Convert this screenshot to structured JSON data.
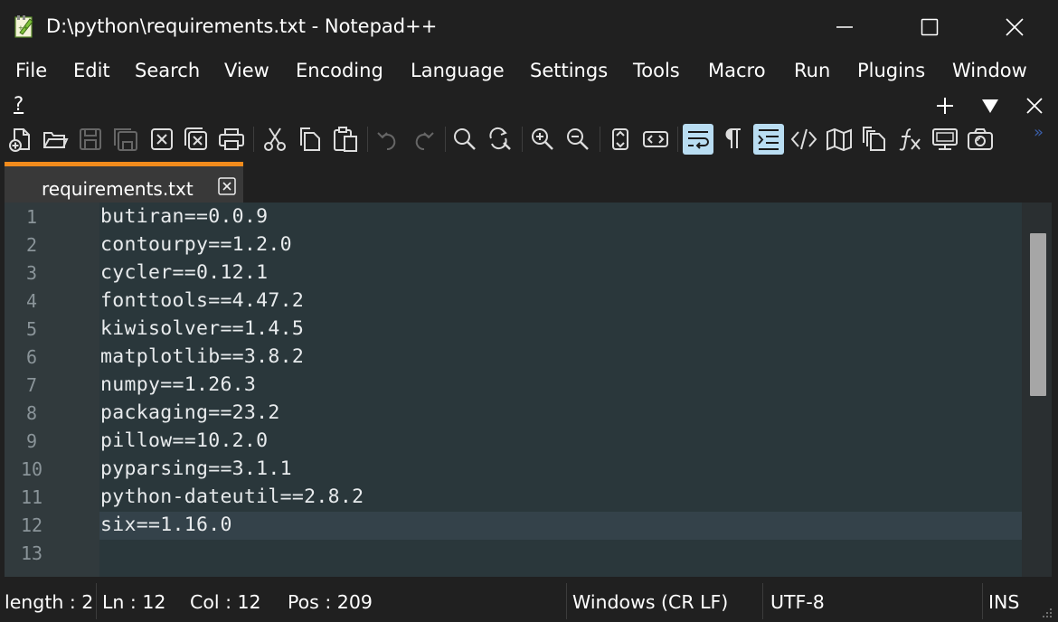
{
  "window": {
    "title": "D:\\python\\requirements.txt - Notepad++"
  },
  "menu": {
    "items": [
      "File",
      "Edit",
      "Search",
      "View",
      "Encoding",
      "Language",
      "Settings",
      "Tools",
      "Macro",
      "Run",
      "Plugins",
      "Window"
    ],
    "help": "?"
  },
  "toolbar": {
    "icons": [
      "new-file-icon",
      "open-file-icon",
      "save-icon",
      "save-all-icon",
      "close-icon",
      "close-all-icon",
      "print-icon",
      "cut-icon",
      "copy-icon",
      "paste-icon",
      "undo-icon",
      "redo-icon",
      "find-icon",
      "replace-icon",
      "zoom-in-icon",
      "zoom-out-icon",
      "sync-vertical-icon",
      "sync-horizontal-icon",
      "word-wrap-icon",
      "show-all-chars-icon",
      "indent-guide-icon",
      "udl-icon",
      "document-map-icon",
      "document-list-icon",
      "function-list-icon",
      "folder-workspace-icon",
      "monitoring-icon"
    ],
    "active": [
      "word-wrap-icon",
      "indent-guide-icon"
    ],
    "overflow": "»"
  },
  "tab": {
    "label": "requirements.txt"
  },
  "editor": {
    "lines": [
      {
        "n": "1",
        "text": "butiran==0.0.9"
      },
      {
        "n": "2",
        "text": "contourpy==1.2.0"
      },
      {
        "n": "3",
        "text": "cycler==0.12.1"
      },
      {
        "n": "4",
        "text": "fonttools==4.47.2"
      },
      {
        "n": "5",
        "text": "kiwisolver==1.4.5"
      },
      {
        "n": "6",
        "text": "matplotlib==3.8.2"
      },
      {
        "n": "7",
        "text": "numpy==1.26.3"
      },
      {
        "n": "8",
        "text": "packaging==23.2"
      },
      {
        "n": "9",
        "text": "pillow==10.2.0"
      },
      {
        "n": "10",
        "text": "pyparsing==3.1.1"
      },
      {
        "n": "11",
        "text": "python-dateutil==2.8.2"
      },
      {
        "n": "12",
        "text": "six==1.16.0"
      },
      {
        "n": "13",
        "text": ""
      }
    ],
    "current_line": 12
  },
  "status": {
    "length": "length : 2",
    "ln": "Ln : 12",
    "col": "Col : 12",
    "pos": "Pos : 209",
    "eol": "Windows (CR LF)",
    "encoding": "UTF-8",
    "mode": "INS"
  },
  "colors": {
    "accent": "#f28b1c",
    "editor_bg": "#2a373b",
    "active_button": "#b9ddf2"
  }
}
